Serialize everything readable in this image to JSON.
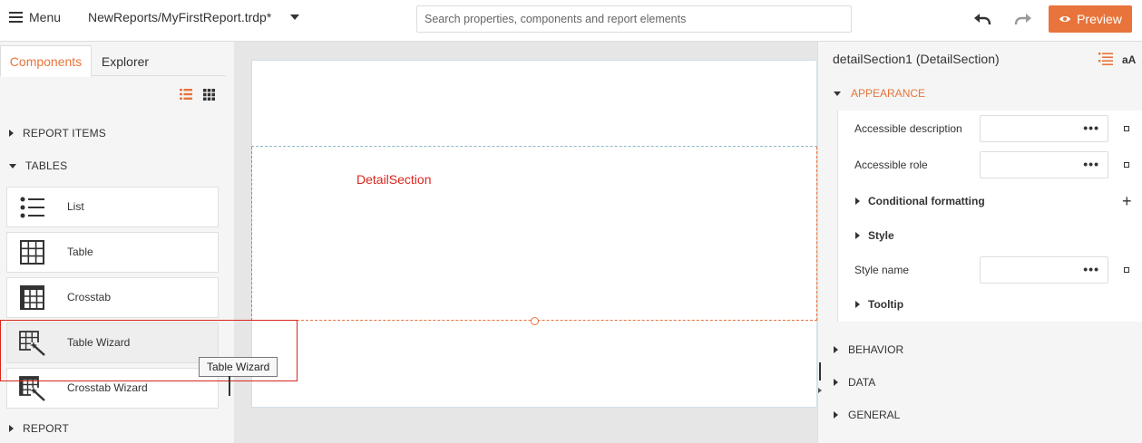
{
  "topbar": {
    "menu_label": "Menu",
    "report_name": "NewReports/MyFirstReport.trdp*",
    "search_placeholder": "Search properties, components and report elements",
    "preview_label": "Preview"
  },
  "left_panel": {
    "tabs": [
      {
        "label": "Components",
        "active": true
      },
      {
        "label": "Explorer",
        "active": false
      }
    ],
    "groups": {
      "report_items": "REPORT ITEMS",
      "tables": "TABLES",
      "report": "REPORT"
    },
    "table_items": [
      {
        "label": "List",
        "icon": "list-icon"
      },
      {
        "label": "Table",
        "icon": "table-icon"
      },
      {
        "label": "Crosstab",
        "icon": "crosstab-icon"
      },
      {
        "label": "Table Wizard",
        "icon": "table-wizard-icon"
      },
      {
        "label": "Crosstab Wizard",
        "icon": "crosstab-wizard-icon"
      }
    ],
    "tooltip": "Table Wizard"
  },
  "canvas": {
    "detail_label": "DetailSection"
  },
  "properties": {
    "title": "detailSection1 (DetailSection)",
    "aa_label": "aA",
    "categories": {
      "appearance": "APPEARANCE",
      "behavior": "BEHAVIOR",
      "data": "DATA",
      "general": "GENERAL"
    },
    "appearance_rows": {
      "accessible_description": "Accessible description",
      "accessible_role": "Accessible role",
      "conditional_formatting": "Conditional formatting",
      "style": "Style",
      "style_name": "Style name",
      "tooltip": "Tooltip"
    },
    "dots": "•••",
    "plus": "+"
  },
  "colors": {
    "accent": "#e8743b",
    "detail_label": "#d9261c",
    "highlight_box": "#d9261c"
  }
}
